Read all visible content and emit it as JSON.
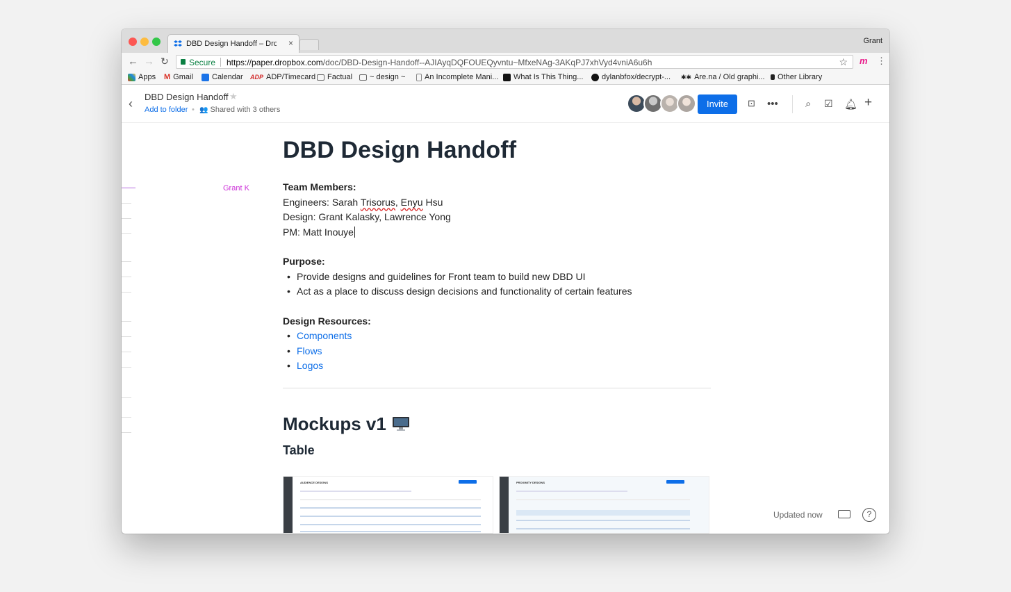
{
  "browser": {
    "tab_title": "DBD Design Handoff – Dropbox",
    "tab_close": "×",
    "user": "Grant",
    "secure_label": "Secure",
    "url_host": "https://paper.dropbox.com",
    "url_path": "/doc/DBD-Design-Handoff--AJIAyqDQFOUEQyvntu~MfxeNAg-3AKqPJ7xhVyd4vniA6u6h",
    "bookmarks": [
      "Apps",
      "Gmail",
      "Calendar",
      "ADP/Timecard",
      "Factual",
      "~ design ~",
      "An Incomplete Mani...",
      "What Is This Thing...",
      "dylanbfox/decrypt-...",
      "Are.na / Old graphi...",
      "Other Library"
    ]
  },
  "header": {
    "doc_title": "DBD Design Handoff",
    "add_to_folder": "Add to folder",
    "shared_text": "Shared with 3 others",
    "invite_label": "Invite"
  },
  "document": {
    "title": "DBD Design Handoff",
    "cursor_user": "Grant K",
    "team_heading": "Team Members:",
    "engineers_prefix": "Engineers: Sarah ",
    "engineers_name1": "Trisorus",
    "engineers_mid": ", ",
    "engineers_name2": "Enyu",
    "engineers_suffix": " Hsu",
    "design_line": "Design: Grant Kalasky, Lawrence Yong",
    "pm_line": "PM: Matt Inouye",
    "purpose_heading": "Purpose:",
    "purpose_items": [
      "Provide designs and guidelines for Front team to build new DBD UI",
      "Act as a place to discuss design decisions and functionality of certain features"
    ],
    "resources_heading": "Design Resources:",
    "resource_links": [
      "Components",
      "Flows",
      "Logos"
    ],
    "mockups_heading": "Mockups v1",
    "table_heading": "Table",
    "thumb1_title": "AUDIENCE DESIGNS",
    "thumb2_title": "PROXIMITY DESIGNS"
  },
  "footer": {
    "status": "Updated now",
    "help": "?"
  },
  "colors": {
    "accent": "#0d6ee8",
    "cursor": "#cc2fd8",
    "secure": "#0b8043"
  }
}
